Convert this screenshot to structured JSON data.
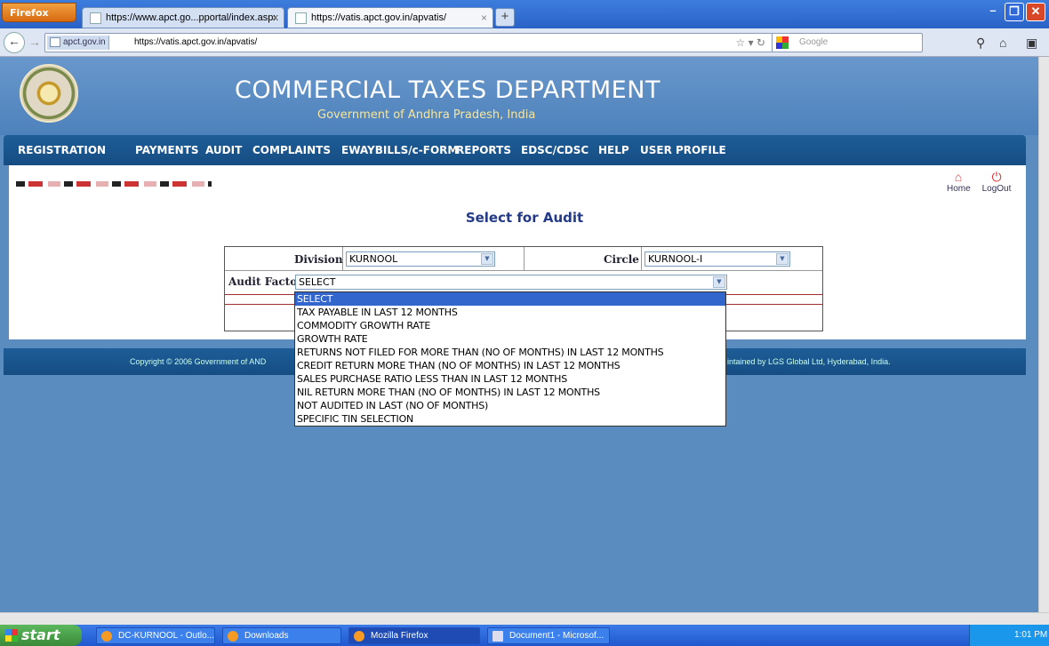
{
  "browser": {
    "firefox_button": "Firefox",
    "tabs": [
      {
        "title": "https://www.apct.go...pportal/index.aspx"
      },
      {
        "title": "https://vatis.apct.gov.in/apvatis/"
      }
    ],
    "site_badge": "apct.gov.in",
    "url": "https://vatis.apct.gov.in/apvatis/",
    "search_placeholder": "Google"
  },
  "header": {
    "title": "COMMERCIAL TAXES DEPARTMENT",
    "subtitle": "Government of Andhra Pradesh, India"
  },
  "menu": [
    "REGISTRATION",
    "PAYMENTS",
    "AUDIT",
    "COMPLAINTS",
    "EWAYBILLS/c-FORM",
    "REPORTS",
    "EDSC/CDSC",
    "HELP",
    "USER PROFILE"
  ],
  "toplinks": {
    "home": "Home",
    "logout": "LogOut"
  },
  "page_title": "Select for Audit",
  "form": {
    "division_label": "Division",
    "division_value": "KURNOOL",
    "circle_label": "Circle",
    "circle_value": "KURNOOL-I",
    "audit_factor_label": "Audit Factor",
    "audit_factor_value": "SELECT"
  },
  "audit_options": [
    "SELECT",
    "TAX PAYABLE IN LAST 12 MONTHS",
    "COMMODITY GROWTH RATE",
    "GROWTH RATE",
    "RETURNS NOT FILED FOR MORE THAN (NO OF MONTHS) IN LAST 12 MONTHS",
    "CREDIT RETURN MORE THAN (NO OF MONTHS) IN LAST 12 MONTHS",
    "SALES PURCHASE RATIO LESS THAN IN LAST 12 MONTHS",
    "NIL RETURN MORE THAN (NO OF MONTHS) IN LAST 12 MONTHS",
    "NOT AUDITED IN LAST (NO OF MONTHS)",
    "SPECIFIC TIN SELECTION"
  ],
  "footer": {
    "left": "Copyright © 2006 Government of AND",
    "right": "intained by LGS Global Ltd, Hyderabad, India."
  },
  "taskbar": {
    "start": "start",
    "tasks": [
      "DC-KURNOOL - Outlo...",
      "Downloads",
      "Mozilla Firefox",
      "Document1 - Microsof..."
    ],
    "clock": "1:01 PM"
  }
}
